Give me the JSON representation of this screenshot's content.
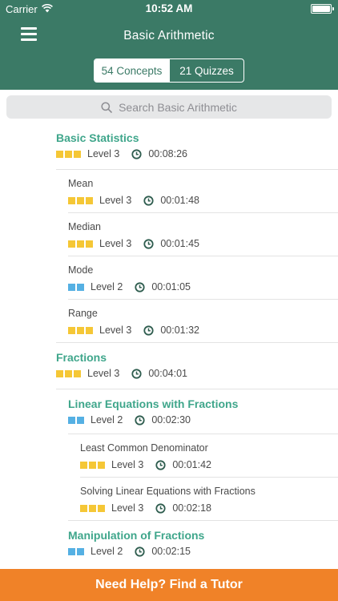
{
  "status_bar": {
    "carrier": "Carrier",
    "time": "10:52 AM"
  },
  "nav": {
    "title": "Basic Arithmetic"
  },
  "segments": {
    "concepts": "54 Concepts",
    "quizzes": "21 Quizzes",
    "selected": "concepts"
  },
  "search": {
    "placeholder": "Search Basic Arithmetic"
  },
  "colors": {
    "header": "#3b7a66",
    "accent": "#3fa68b",
    "cta": "#f08228",
    "level3": "#f5c736",
    "level2": "#55b0e3"
  },
  "list": [
    {
      "title": "Basic Statistics",
      "level": "Level 3",
      "duration": "00:08:26"
    },
    {
      "title": "Mean",
      "level": "Level 3",
      "duration": "00:01:48"
    },
    {
      "title": "Median",
      "level": "Level 3",
      "duration": "00:01:45"
    },
    {
      "title": "Mode",
      "level": "Level 2",
      "duration": "00:01:05"
    },
    {
      "title": "Range",
      "level": "Level 3",
      "duration": "00:01:32"
    },
    {
      "title": "Fractions",
      "level": "Level 3",
      "duration": "00:04:01"
    },
    {
      "title": "Linear Equations with Fractions",
      "level": "Level 2",
      "duration": "00:02:30"
    },
    {
      "title": "Least Common Denominator",
      "level": "Level 3",
      "duration": "00:01:42"
    },
    {
      "title": "Solving Linear Equations with Fractions",
      "level": "Level 3",
      "duration": "00:02:18"
    },
    {
      "title": "Manipulation of Fractions",
      "level": "Level 2",
      "duration": "00:02:15"
    }
  ],
  "cta": {
    "label": "Need Help?  Find a Tutor"
  }
}
